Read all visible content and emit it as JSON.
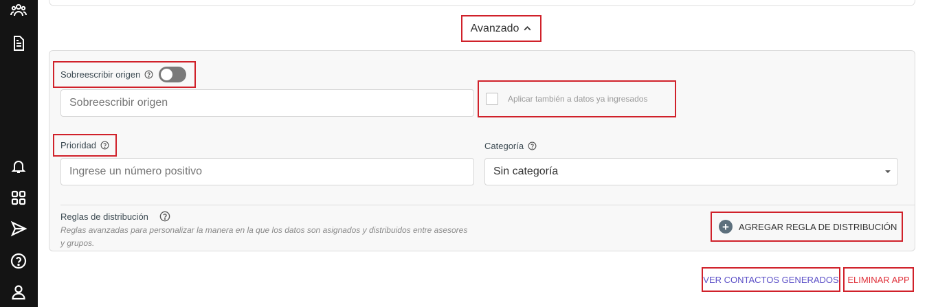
{
  "sidebar": {
    "icons": [
      "users-icon",
      "document-icon",
      "bell-icon",
      "apps-grid-icon",
      "send-icon",
      "help-circle-icon",
      "user-icon"
    ]
  },
  "advanced": {
    "toggle_label": "Avanzado"
  },
  "override_origin": {
    "label": "Sobreescribir origen",
    "toggle_on": false,
    "input_placeholder": "Sobreescribir origen",
    "input_value": ""
  },
  "apply_existing": {
    "label": "Aplicar también a datos ya ingresados",
    "checked": false
  },
  "priority": {
    "label": "Prioridad",
    "input_placeholder": "Ingrese un número positivo",
    "input_value": ""
  },
  "category": {
    "label": "Categoría",
    "selected": "Sin categoría"
  },
  "distribution_rules": {
    "label": "Reglas de distribución",
    "description": "Reglas avanzadas para personalizar la manera en la que los datos son asignados y distribuidos entre asesores y grupos.",
    "add_button": "AGREGAR REGLA DE DISTRIBUCIÓN"
  },
  "footer": {
    "view_contacts": "VER CONTACTOS GENERADOS",
    "delete_app": "ELIMINAR APP"
  },
  "colors": {
    "sidebar_bg": "#141414",
    "highlight": "#d0212a",
    "view_link": "#5b4fc7",
    "delete_link": "#e0333c"
  }
}
